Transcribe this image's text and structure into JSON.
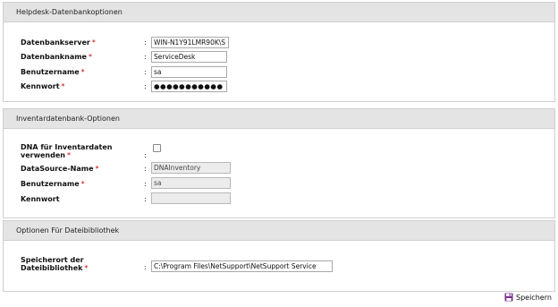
{
  "sections": {
    "helpdesk": {
      "title": "Helpdesk-Datenbankoptionen",
      "fields": {
        "server": {
          "label": "Datenbankserver",
          "value": "WIN-N1Y91LMR90K\\S"
        },
        "dbname": {
          "label": "Datenbankname",
          "value": "ServiceDesk"
        },
        "username": {
          "label": "Benutzername",
          "value": "sa"
        },
        "password": {
          "label": "Kennwort",
          "value": "●●●●●●●●●●●"
        }
      }
    },
    "inventory": {
      "title": "Inventardatenbank-Optionen",
      "fields": {
        "dna": {
          "label_line1": "DNA für Inventardaten",
          "label_line2": "verwenden",
          "checked": false
        },
        "datasource": {
          "label": "DataSource-Name",
          "value": "DNAInventory"
        },
        "username": {
          "label": "Benutzername",
          "value": "sa"
        },
        "password": {
          "label": "Kennwort",
          "value": ""
        }
      }
    },
    "filelib": {
      "title": "Optionen Für Dateibibliothek",
      "fields": {
        "location": {
          "label_line1": "Speicherort der",
          "label_line2": "Dateibibliothek",
          "value": "C:\\Program Files\\NetSupport\\NetSupport Service"
        }
      }
    }
  },
  "common": {
    "required_mark": "*",
    "colon": ":"
  },
  "actions": {
    "save_label": "Speichern"
  },
  "colors": {
    "accent": "#7a2f8f",
    "required": "#cc0000"
  }
}
